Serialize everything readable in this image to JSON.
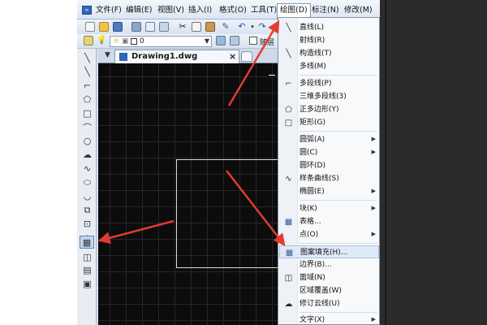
{
  "menubar": {
    "items": [
      {
        "label": "文件(F)"
      },
      {
        "label": "编辑(E)"
      },
      {
        "label": "视图(V)"
      },
      {
        "label": "插入(I)"
      },
      {
        "label": "格式(O)"
      },
      {
        "label": "工具(T)"
      },
      {
        "label": "绘图(D)",
        "active": true
      },
      {
        "label": "标注(N)"
      },
      {
        "label": "修改(M)"
      }
    ]
  },
  "toolbar": {
    "layer_value": "0",
    "checkbox_label": "随层"
  },
  "document": {
    "tab_label": "Drawing1.dwg",
    "close_label": "×"
  },
  "draw_menu": {
    "items": [
      {
        "label": "直线(L)",
        "icon": "line-icon"
      },
      {
        "label": "射线(R)",
        "icon": "ray-icon"
      },
      {
        "label": "构造线(T)",
        "icon": "construction-line-icon"
      },
      {
        "label": "多线(M)",
        "icon": "multiline-icon"
      },
      {
        "label": "多段线(P)",
        "icon": "polyline-icon"
      },
      {
        "label": "三维多段线(3)",
        "icon": "3d-polyline-icon"
      },
      {
        "label": "正多边形(Y)",
        "icon": "polygon-icon"
      },
      {
        "label": "矩形(G)",
        "icon": "rectangle-icon"
      },
      {
        "label": "圆弧(A)",
        "icon": "arc-icon",
        "submenu": true
      },
      {
        "label": "圆(C)",
        "icon": "circle-icon",
        "submenu": true
      },
      {
        "label": "圆环(D)",
        "icon": "donut-icon"
      },
      {
        "label": "样条曲线(S)",
        "icon": "spline-icon"
      },
      {
        "label": "椭圆(E)",
        "icon": "ellipse-icon",
        "submenu": true
      },
      {
        "label": "块(K)",
        "icon": "block-icon",
        "submenu": true
      },
      {
        "label": "表格...",
        "icon": "table-icon"
      },
      {
        "label": "点(O)",
        "icon": "point-icon",
        "submenu": true
      },
      {
        "label": "图案填充(H)...",
        "icon": "hatch-icon",
        "highlighted": true
      },
      {
        "label": "边界(B)...",
        "icon": "boundary-icon"
      },
      {
        "label": "面域(N)",
        "icon": "region-icon"
      },
      {
        "label": "区域覆盖(W)",
        "icon": "wipeout-icon"
      },
      {
        "label": "修订云线(U)",
        "icon": "revcloud-icon"
      },
      {
        "label": "文字(X)",
        "icon": "text-icon",
        "submenu": true
      }
    ]
  },
  "left_toolbar": {
    "icons": [
      "line-icon",
      "construction-line-icon",
      "polyline-icon",
      "polygon-icon",
      "rectangle-icon",
      "arc-icon",
      "circle-icon",
      "revcloud-icon",
      "spline-icon",
      "ellipse-icon",
      "ellipse-arc-icon",
      "insert-block-icon",
      "make-block-icon",
      "point-icon",
      "hatch-icon",
      "region-icon",
      "table-icon",
      "image-icon"
    ]
  },
  "colors": {
    "annotation_arrow": "#e23b30",
    "canvas_background": "#0c0c0c",
    "highlight": "#dfeaf8"
  }
}
